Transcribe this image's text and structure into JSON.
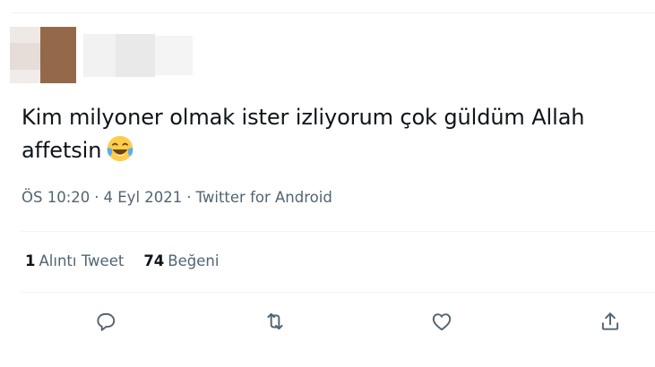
{
  "tweet": {
    "text": "Kim milyoner olmak ister izliyorum çok güldüm Allah affetsin",
    "emoji_icon": "face-with-tears-of-joy-icon",
    "time": "ÖS 10:20",
    "date": "4 Eyl 2021",
    "source": "Twitter for Android",
    "separator": "·"
  },
  "stats": {
    "quote_count": "1",
    "quote_label": "Alıntı Tweet",
    "like_count": "74",
    "like_label": "Beğeni"
  },
  "actions": [
    {
      "icon": "reply-icon"
    },
    {
      "icon": "retweet-icon"
    },
    {
      "icon": "like-icon"
    },
    {
      "icon": "share-icon"
    }
  ],
  "colors": {
    "text_primary": "#0f1419",
    "text_secondary": "#536471",
    "divider": "#eff3f4"
  }
}
